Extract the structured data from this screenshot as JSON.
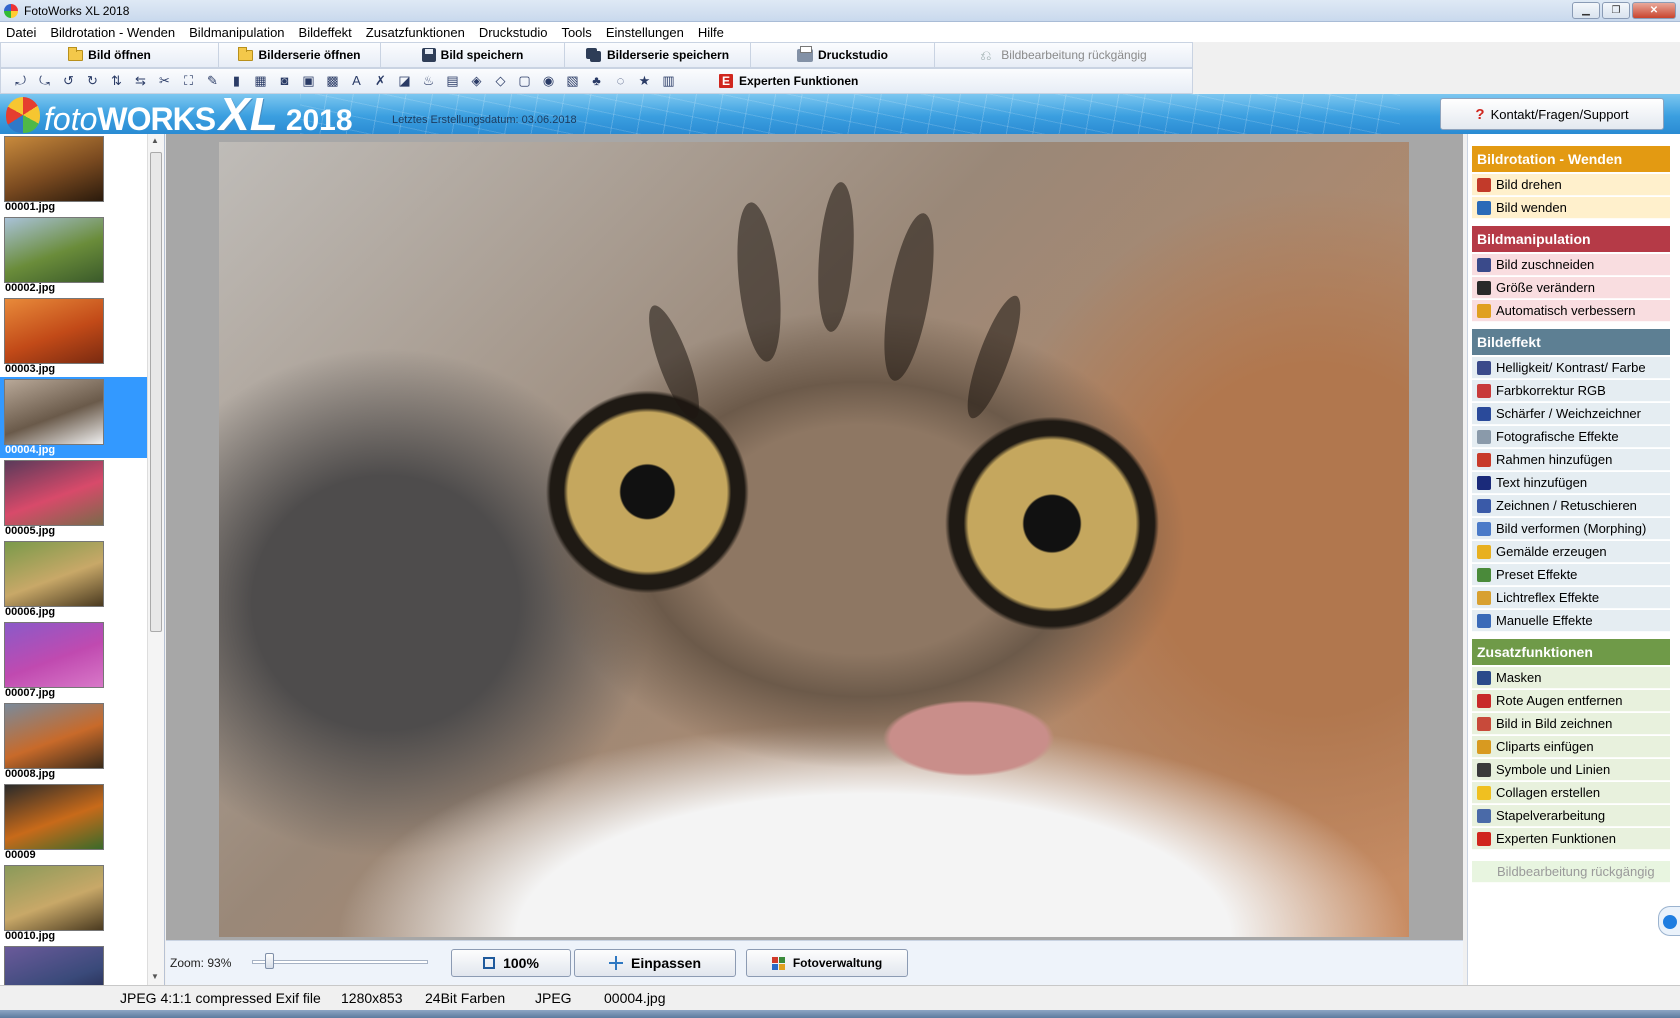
{
  "window": {
    "title": "FotoWorks XL 2018",
    "minimize_glyph": "▁",
    "maximize_glyph": "❐",
    "close_glyph": "✕"
  },
  "menu": [
    "Datei",
    "Bildrotation - Wenden",
    "Bildmanipulation",
    "Bildeffekt",
    "Zusatzfunktionen",
    "Druckstudio",
    "Tools",
    "Einstellungen",
    "Hilfe"
  ],
  "toolbar": {
    "open_image": "Bild öffnen",
    "open_series": "Bilderserie öffnen",
    "save_image": "Bild speichern",
    "save_series": "Bilderserie speichern",
    "print_studio": "Druckstudio",
    "undo": "Bildbearbeitung rückgängig",
    "expert": "Experten Funktionen",
    "expert_icon_letter": "E"
  },
  "tool_icons": [
    "rotate-left-icon",
    "rotate-right-icon",
    "rotate-ccw-icon",
    "rotate-cw-icon",
    "flip-icon",
    "mirror-icon",
    "scissors-icon",
    "crop-icon",
    "magic-wand-icon",
    "brightness-icon",
    "rgb-icon",
    "sharpen-icon",
    "photo-effect-icon",
    "frame-icon",
    "text-icon",
    "retouch-icon",
    "morph-icon",
    "painting-icon",
    "preset-icon",
    "light-icon",
    "manual-icon",
    "mask-icon",
    "red-eye-icon",
    "picture-in-picture-icon",
    "clipart-icon",
    "symbols-icon",
    "star-icon",
    "batch-icon"
  ],
  "tool_glyphs": [
    "⤾",
    "⤿",
    "↺",
    "↻",
    "⇅",
    "⇆",
    "✂",
    "⛶",
    "✎",
    "▮",
    "▦",
    "◙",
    "▣",
    "▩",
    "A",
    "✗",
    "◪",
    "♨",
    "▤",
    "◈",
    "◇",
    "▢",
    "◉",
    "▧",
    "♣",
    "◌",
    "★",
    "▥"
  ],
  "banner": {
    "logo_foto": "foto",
    "logo_works": "WORKS",
    "logo_xl": "XL",
    "logo_year": "2018",
    "last_date": "Letztes Erstellungsdatum: 03.06.2018",
    "support_icon": "?",
    "support_button": "Kontakt/Fragen/Support"
  },
  "thumbnails": [
    {
      "name": "00001.jpg",
      "colors": [
        "#7a4a20",
        "#c88a3c",
        "#2a1a0c"
      ]
    },
    {
      "name": "00002.jpg",
      "colors": [
        "#6a8c3a",
        "#a9c2d8",
        "#3a5a2a"
      ]
    },
    {
      "name": "00003.jpg",
      "colors": [
        "#c24a18",
        "#e88a3a",
        "#7a2a10"
      ]
    },
    {
      "name": "00004.jpg",
      "colors": [
        "#6a5a4a",
        "#b8a898",
        "#f0f0f0"
      ]
    },
    {
      "name": "00005.jpg",
      "colors": [
        "#d84a6a",
        "#5a3a5a",
        "#7a6a4a"
      ]
    },
    {
      "name": "00006.jpg",
      "colors": [
        "#c8a868",
        "#7a9a4a",
        "#4a3a20"
      ]
    },
    {
      "name": "00007.jpg",
      "colors": [
        "#c04ab0",
        "#8a5ac8",
        "#d878c8"
      ]
    },
    {
      "name": "00008.jpg",
      "colors": [
        "#c86a2a",
        "#7a8a9a",
        "#3a2a1a"
      ]
    },
    {
      "name": "00009",
      "colors": [
        "#c86a1a",
        "#2a2a2a",
        "#3a6a2a"
      ]
    },
    {
      "name": "00010.jpg",
      "colors": [
        "#c8a868",
        "#8a9a5a",
        "#4a3a20"
      ]
    },
    {
      "name": "",
      "colors": [
        "#3a4a7a",
        "#6a5a9a",
        "#1a1a3a"
      ]
    }
  ],
  "selected_thumbnail": 3,
  "viewer": {
    "zoom_label": "Zoom: 93%",
    "zoom_level": 0.08,
    "btn_100": "100%",
    "btn_fit": "Einpassen",
    "btn_manager": "Fotoverwaltung"
  },
  "side_panel": {
    "sections": [
      {
        "title": "Bildrotation - Wenden",
        "color": "#e39a12",
        "item_bg": "#fff0cc",
        "items": [
          {
            "label": "Bild drehen",
            "icon": "rotate-image-icon",
            "icon_color": "#c23a2a"
          },
          {
            "label": "Bild wenden",
            "icon": "flip-image-icon",
            "icon_color": "#2a6ab8"
          }
        ]
      },
      {
        "title": "Bildmanipulation",
        "color": "#b53a47",
        "item_bg": "#f9dde0",
        "items": [
          {
            "label": "Bild zuschneiden",
            "icon": "scissors-icon",
            "icon_color": "#3a4a8a"
          },
          {
            "label": "Größe verändern",
            "icon": "resize-icon",
            "icon_color": "#2a2a2a"
          },
          {
            "label": "Automatisch verbessern",
            "icon": "magic-wand-icon",
            "icon_color": "#e0a020"
          }
        ]
      },
      {
        "title": "Bildeffekt",
        "color": "#5d7f93",
        "item_bg": "#e5edf2",
        "items": [
          {
            "label": "Helligkeit/ Kontrast/ Farbe",
            "icon": "brightness-icon",
            "icon_color": "#3a4a8a"
          },
          {
            "label": "Farbkorrektur RGB",
            "icon": "rgb-icon",
            "icon_color": "#c83a3a"
          },
          {
            "label": "Schärfer / Weichzeichner",
            "icon": "sharpen-icon",
            "icon_color": "#2a4a9a"
          },
          {
            "label": "Fotografische Effekte",
            "icon": "photo-effect-icon",
            "icon_color": "#8a9aaa"
          },
          {
            "label": "Rahmen hinzufügen",
            "icon": "frame-icon",
            "icon_color": "#c83a2a"
          },
          {
            "label": "Text hinzufügen",
            "icon": "text-icon",
            "icon_color": "#1a2a7a"
          },
          {
            "label": "Zeichnen / Retuschieren",
            "icon": "brush-icon",
            "icon_color": "#3a5aa8"
          },
          {
            "label": "Bild verformen (Morphing)",
            "icon": "morph-icon",
            "icon_color": "#4a7ac8"
          },
          {
            "label": "Gemälde erzeugen",
            "icon": "painting-icon",
            "icon_color": "#e8b020"
          },
          {
            "label": "Preset Effekte",
            "icon": "preset-icon",
            "icon_color": "#4a8a3a"
          },
          {
            "label": "Lichtreflex Effekte",
            "icon": "light-reflex-icon",
            "icon_color": "#d8a030"
          },
          {
            "label": "Manuelle Effekte",
            "icon": "manual-effect-icon",
            "icon_color": "#3a6ab8"
          }
        ]
      },
      {
        "title": "Zusatzfunktionen",
        "color": "#6f9a48",
        "item_bg": "#e8f1dd",
        "items": [
          {
            "label": "Masken",
            "icon": "mask-icon",
            "icon_color": "#2a4a8a"
          },
          {
            "label": "Rote Augen entfernen",
            "icon": "red-eye-icon",
            "icon_color": "#c82a2a"
          },
          {
            "label": "Bild in Bild zeichnen",
            "icon": "picture-in-picture-icon",
            "icon_color": "#c84a3a"
          },
          {
            "label": "Cliparts einfügen",
            "icon": "clipart-icon",
            "icon_color": "#d89a20"
          },
          {
            "label": "Symbole und Linien",
            "icon": "symbols-icon",
            "icon_color": "#3a3a3a"
          },
          {
            "label": "Collagen erstellen",
            "icon": "star-icon",
            "icon_color": "#f0c020"
          },
          {
            "label": "Stapelverarbeitung",
            "icon": "batch-icon",
            "icon_color": "#4a6aa8"
          },
          {
            "label": "Experten Funktionen",
            "icon": "expert-icon",
            "icon_color": "#d0261e"
          }
        ]
      }
    ],
    "undo": "Bildbearbeitung rückgängig",
    "undo_bg": "#e8f5e0"
  },
  "status": {
    "format": "JPEG 4:1:1 compressed Exif file",
    "dimensions": "1280x853",
    "colors": "24Bit Farben",
    "type": "JPEG",
    "file": "00004.jpg"
  }
}
